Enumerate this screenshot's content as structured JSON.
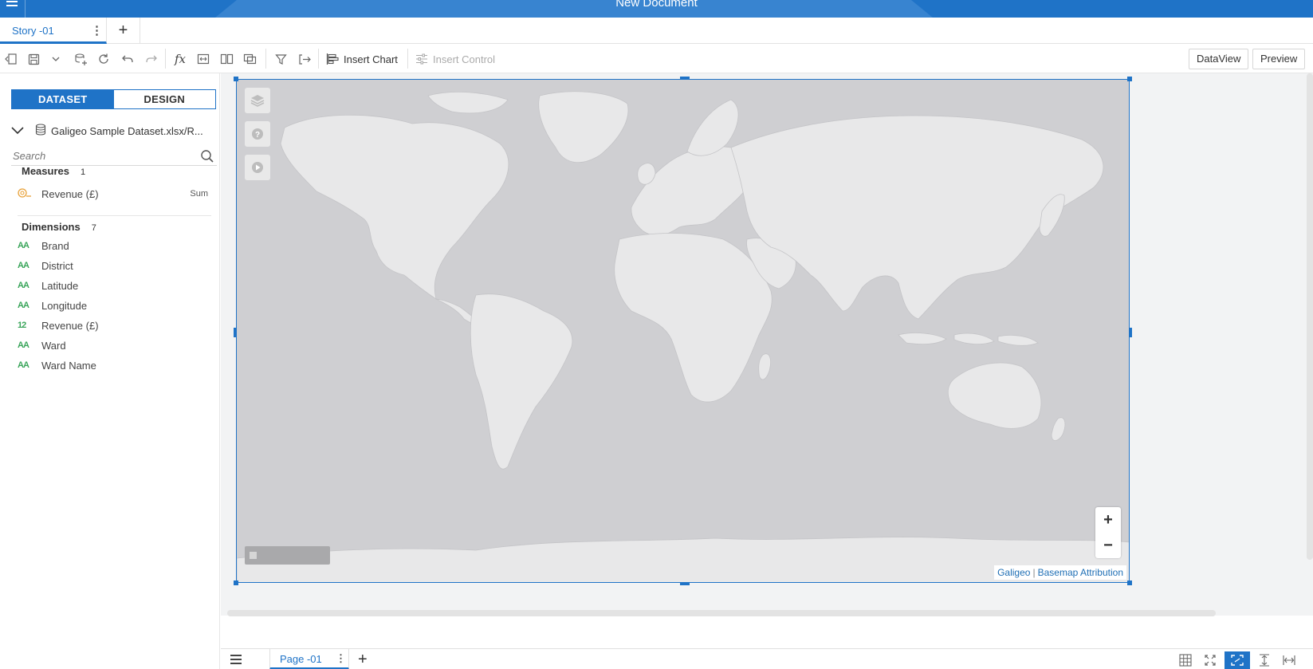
{
  "header": {
    "title": "New Document"
  },
  "story_tabs": [
    {
      "label": "Story -01"
    }
  ],
  "toolbar": {
    "insert_chart": "Insert Chart",
    "insert_control": "Insert Control",
    "data_view": "DataView",
    "preview": "Preview",
    "fx_label": "fx"
  },
  "left_panel": {
    "tabs": {
      "dataset": "DATASET",
      "design": "DESIGN"
    },
    "dataset_name": "Galigeo Sample Dataset.xlsx/R...",
    "search_placeholder": "Search",
    "measures": {
      "title": "Measures",
      "count": "1",
      "items": [
        {
          "icon": "measure-icon",
          "name": "Revenue (£)",
          "aggregation": "Sum"
        }
      ]
    },
    "dimensions": {
      "title": "Dimensions",
      "count": "7",
      "items": [
        {
          "icon_text": "AA",
          "name": "Brand"
        },
        {
          "icon_text": "AA",
          "name": "District"
        },
        {
          "icon_text": "AA",
          "name": "Latitude"
        },
        {
          "icon_text": "AA",
          "name": "Longitude"
        },
        {
          "icon_text": "12",
          "name": "Revenue (£)"
        },
        {
          "icon_text": "AA",
          "name": "Ward"
        },
        {
          "icon_text": "AA",
          "name": "Ward Name"
        }
      ]
    }
  },
  "map": {
    "attribution_brand": "Galigeo",
    "attribution_separator": "|",
    "attribution_link": "Basemap Attribution",
    "zoom_in": "+",
    "zoom_out": "−"
  },
  "page_tabs": [
    {
      "label": "Page -01"
    }
  ],
  "colors": {
    "accent": "#1f73c7",
    "ocean": "#cfcfd2",
    "land": "#e8e8e9",
    "dimension_icon": "#3aa55a",
    "measure_icon": "#e8a23a"
  }
}
